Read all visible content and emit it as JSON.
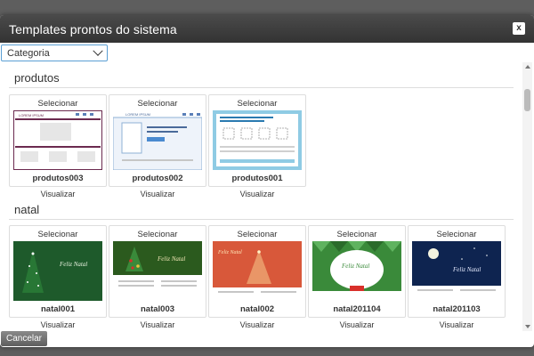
{
  "dialog": {
    "title": "Templates prontos do sistema",
    "close_label": "x"
  },
  "filter": {
    "selected": "Categoria"
  },
  "sections": [
    {
      "title": "produtos",
      "templates": [
        {
          "select_label": "Selecionar",
          "name": "produtos003",
          "preview_label": "Visualizar"
        },
        {
          "select_label": "Selecionar",
          "name": "produtos002",
          "preview_label": "Visualizar"
        },
        {
          "select_label": "Selecionar",
          "name": "produtos001",
          "preview_label": "Visualizar"
        }
      ]
    },
    {
      "title": "natal",
      "templates": [
        {
          "select_label": "Selecionar",
          "name": "natal001",
          "preview_label": "Visualizar"
        },
        {
          "select_label": "Selecionar",
          "name": "natal003",
          "preview_label": "Visualizar"
        },
        {
          "select_label": "Selecionar",
          "name": "natal002",
          "preview_label": "Visualizar"
        },
        {
          "select_label": "Selecionar",
          "name": "natal201104",
          "preview_label": "Visualizar"
        },
        {
          "select_label": "Selecionar",
          "name": "natal201103",
          "preview_label": "Visualizar"
        }
      ]
    }
  ],
  "thumb_text": {
    "lorem": "LOREM IPSUM",
    "feliz_natal": "Feliz Natal"
  },
  "footer": {
    "cancel_label": "Cancelar"
  },
  "colors": {
    "titlebar": "#3d3d3d",
    "select_border": "#5a9fd4",
    "produtos003_frame": "#6b2a4f",
    "produtos002_frame": "#8fb0d6",
    "produtos001_frame": "#8fcbe4",
    "natal001_bg": "#1e5a2b",
    "natal003_bg": "#2b5a1e",
    "natal002_bg": "#d8583a",
    "natal201104_bg": "#3a8a3a",
    "natal201103_bg": "#0e2450"
  }
}
